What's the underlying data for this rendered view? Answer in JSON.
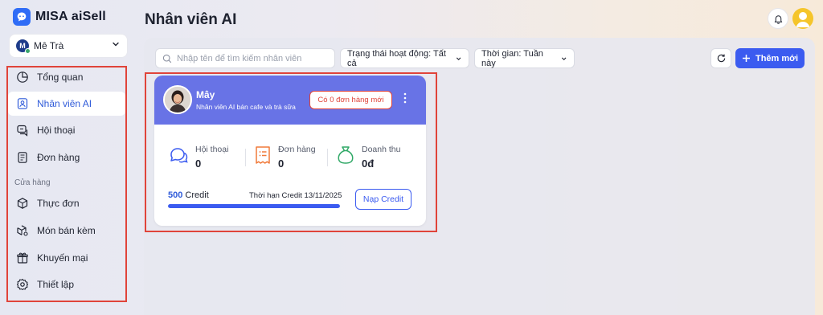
{
  "app": {
    "brand": "MISA aiSell",
    "page_title": "Nhân viên AI"
  },
  "store": {
    "initial": "M",
    "name": "Mê Trà"
  },
  "sidebar": {
    "items": [
      {
        "label": "Tổng quan",
        "icon": "pie-chart-icon",
        "active": false
      },
      {
        "label": "Nhân viên AI",
        "icon": "id-badge-icon",
        "active": true
      },
      {
        "label": "Hội thoại",
        "icon": "chat-bubble-icon",
        "active": false
      },
      {
        "label": "Đơn hàng",
        "icon": "receipt-icon",
        "active": false
      }
    ],
    "section_label": "Cửa hàng",
    "store_items": [
      {
        "label": "Thực đơn",
        "icon": "box-icon"
      },
      {
        "label": "Món bán kèm",
        "icon": "box-settings-icon"
      },
      {
        "label": "Khuyến mại",
        "icon": "gift-icon"
      },
      {
        "label": "Thiết lập",
        "icon": "gear-icon"
      }
    ]
  },
  "toolbar": {
    "search_placeholder": "Nhập tên để tìm kiếm nhân viên",
    "status_filter": "Trạng thái hoạt động: Tất cả",
    "time_filter": "Thời gian: Tuần này",
    "add_label": "Thêm mới"
  },
  "agent_card": {
    "name": "Mây",
    "description": "Nhân viên AI bán cafe và trà sữa",
    "order_badge": "Có 0 đơn hàng mới",
    "stats": [
      {
        "label": "Hội thoại",
        "value": "0",
        "icon": "chat-bubble-icon",
        "color": "#3b5bf0"
      },
      {
        "label": "Đơn hàng",
        "value": "0",
        "icon": "receipt-icon",
        "color": "#f07a3a"
      },
      {
        "label": "Doanh thu",
        "value": "0đ",
        "icon": "money-bag-icon",
        "color": "#2fa866"
      }
    ],
    "credit_value": "500",
    "credit_unit": "Credit",
    "credit_expiry": "Thời hạn Credit 13/11/2025",
    "credit_fraction": 1.0,
    "topup_label": "Nạp Credit"
  },
  "colors": {
    "accent": "#3b5bf0",
    "card_header": "#6873e6",
    "highlight": "#e0443a"
  }
}
